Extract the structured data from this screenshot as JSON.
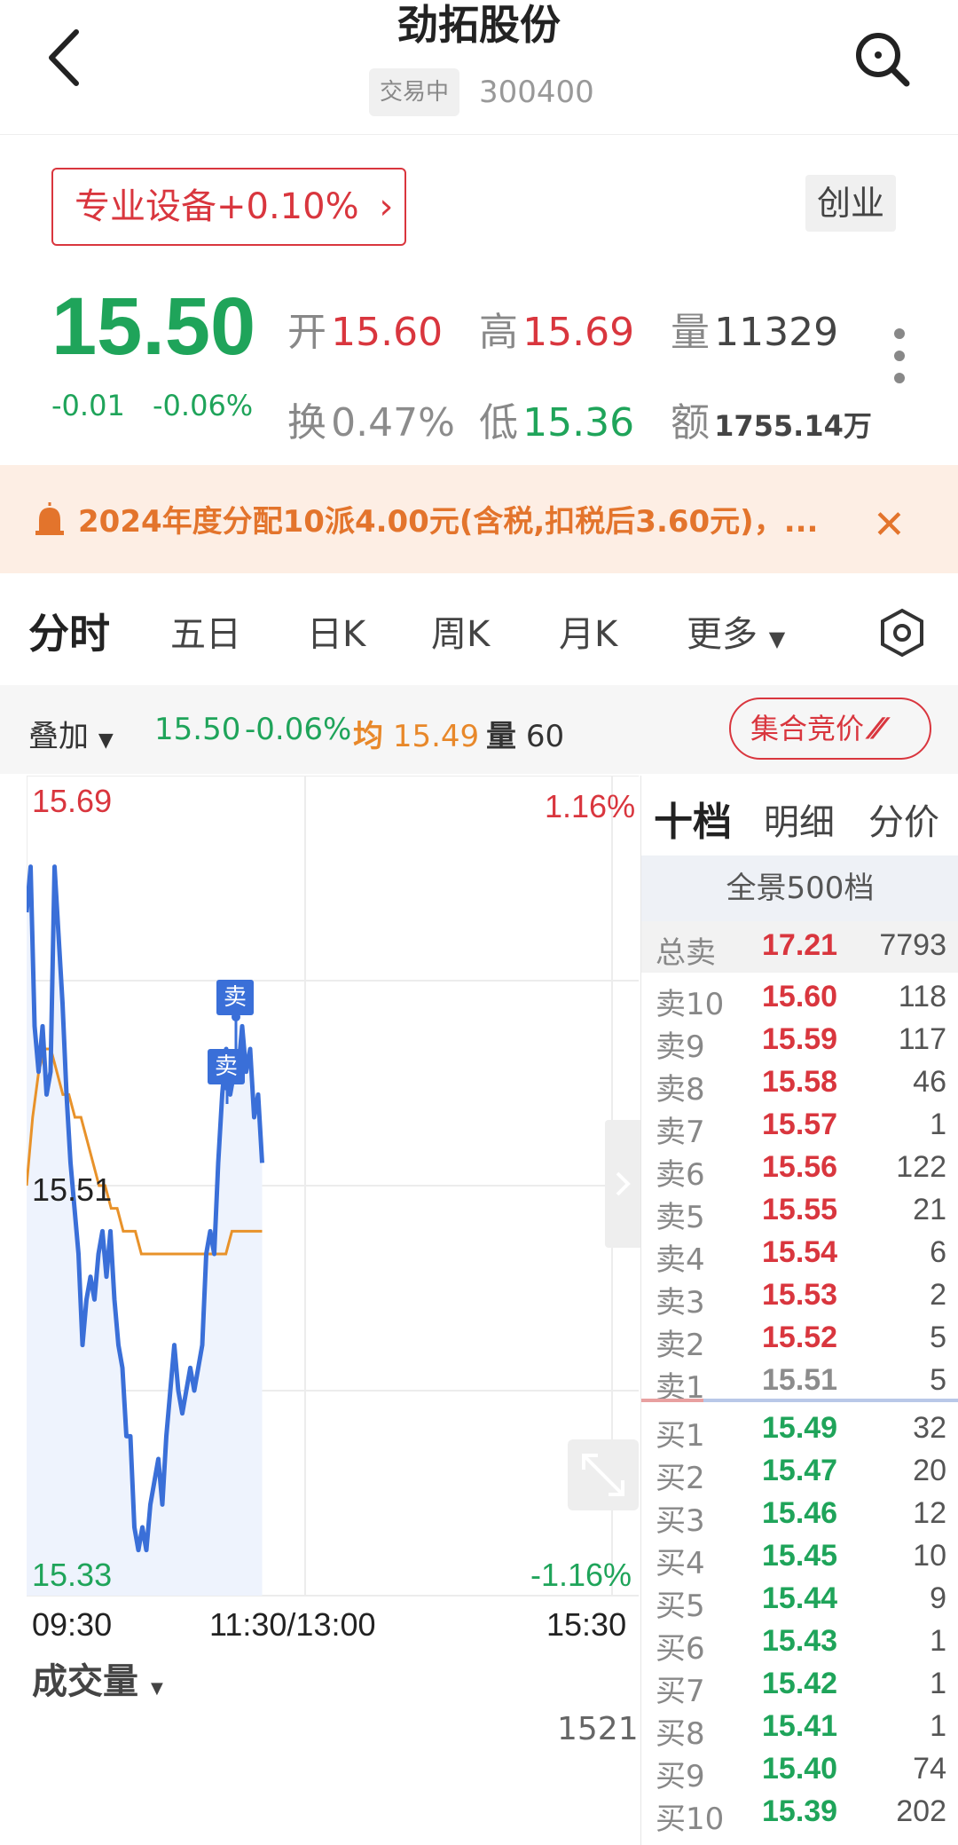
{
  "header": {
    "title": "劲拓股份",
    "status": "交易中",
    "code": "300400"
  },
  "sector": {
    "label": "专业设备+0.10%",
    "board": "创业"
  },
  "quote": {
    "price": "15.50",
    "change": "-0.01",
    "change_pct": "-0.06%",
    "open_label": "开",
    "open": "15.60",
    "high_label": "高",
    "high": "15.69",
    "volume_label": "量",
    "volume": "11329",
    "turnover_label": "换",
    "turnover": "0.47%",
    "low_label": "低",
    "low": "15.36",
    "amount_label": "额",
    "amount": "1755.14万"
  },
  "notice": {
    "text": "2024年度分配10派4.00元(含税,扣税后3.60元)，..."
  },
  "tabs": [
    "分时",
    "五日",
    "日K",
    "周K",
    "月K",
    "更多"
  ],
  "overlay": {
    "label": "叠加",
    "price": "15.50",
    "pct": "-0.06%",
    "avg_label": "均",
    "avg": "15.49",
    "vol_label": "量",
    "vol": "60",
    "auction": "集合竞价"
  },
  "chart_data": {
    "type": "line",
    "title": "",
    "y_top": "15.69",
    "y_mid": "15.51",
    "y_bottom": "15.33",
    "pct_top": "1.16%",
    "pct_bottom": "-1.16%",
    "ylim": [
      15.33,
      15.69
    ],
    "x_ticks": [
      "09:30",
      "11:30/13:00",
      "15:30"
    ],
    "trade_marker": "卖",
    "series": [
      {
        "values": [
          15.63,
          15.65,
          15.58,
          15.56,
          15.58,
          15.55,
          15.56,
          15.65,
          15.62,
          15.59,
          15.55,
          15.52,
          15.5,
          15.48,
          15.44,
          15.46,
          15.47,
          15.46,
          15.48,
          15.49,
          15.47,
          15.49,
          15.46,
          15.44,
          15.43,
          15.4,
          15.4,
          15.36,
          15.35,
          15.36,
          15.35,
          15.37,
          15.38,
          15.39,
          15.37,
          15.4,
          15.42,
          15.44,
          15.42,
          15.41,
          15.42,
          15.43,
          15.42,
          15.43,
          15.44,
          15.48,
          15.49,
          15.48,
          15.52,
          15.55,
          15.57,
          15.55,
          15.56,
          15.56,
          15.58,
          15.56,
          15.57,
          15.54,
          15.55,
          15.52
        ]
      },
      {
        "values": [
          15.51,
          15.54,
          15.56,
          15.57,
          15.57,
          15.56,
          15.55,
          15.55,
          15.54,
          15.54,
          15.53,
          15.52,
          15.51,
          15.51,
          15.5,
          15.5,
          15.49,
          15.49,
          15.49,
          15.48,
          15.48,
          15.48,
          15.48,
          15.48,
          15.48,
          15.48,
          15.48,
          15.48,
          15.48,
          15.48,
          15.48,
          15.48,
          15.48,
          15.48,
          15.49,
          15.49,
          15.49,
          15.49,
          15.49,
          15.49
        ]
      }
    ],
    "volume_max": "1521",
    "volume_title": "成交量"
  },
  "orderbook": {
    "tabs": [
      "十档",
      "明细",
      "分价"
    ],
    "panorama": "全景500档",
    "total_label": "总卖",
    "total_price": "17.21",
    "total_vol": "7793",
    "asks": [
      {
        "label": "卖10",
        "price": "15.60",
        "vol": "118"
      },
      {
        "label": "卖9",
        "price": "15.59",
        "vol": "117"
      },
      {
        "label": "卖8",
        "price": "15.58",
        "vol": "46"
      },
      {
        "label": "卖7",
        "price": "15.57",
        "vol": "1"
      },
      {
        "label": "卖6",
        "price": "15.56",
        "vol": "122"
      },
      {
        "label": "卖5",
        "price": "15.55",
        "vol": "21"
      },
      {
        "label": "卖4",
        "price": "15.54",
        "vol": "6"
      },
      {
        "label": "卖3",
        "price": "15.53",
        "vol": "2"
      },
      {
        "label": "卖2",
        "price": "15.52",
        "vol": "5"
      },
      {
        "label": "卖1",
        "price": "15.51",
        "vol": "5"
      }
    ],
    "bids": [
      {
        "label": "买1",
        "price": "15.49",
        "vol": "32"
      },
      {
        "label": "买2",
        "price": "15.47",
        "vol": "20"
      },
      {
        "label": "买3",
        "price": "15.46",
        "vol": "12"
      },
      {
        "label": "买4",
        "price": "15.45",
        "vol": "10"
      },
      {
        "label": "买5",
        "price": "15.44",
        "vol": "9"
      },
      {
        "label": "买6",
        "price": "15.43",
        "vol": "1"
      },
      {
        "label": "买7",
        "price": "15.42",
        "vol": "1"
      },
      {
        "label": "买8",
        "price": "15.41",
        "vol": "1"
      },
      {
        "label": "买9",
        "price": "15.40",
        "vol": "74"
      },
      {
        "label": "买10",
        "price": "15.39",
        "vol": "202"
      }
    ]
  },
  "colors": {
    "up": "#d9363e",
    "down": "#1fa45a",
    "price_line": "#3a6fd8",
    "avg_line": "#e8922a"
  }
}
